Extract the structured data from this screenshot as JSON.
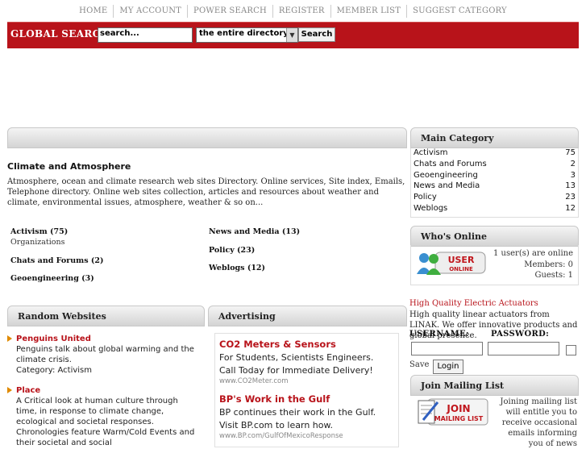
{
  "nav": [
    "HOME",
    "MY ACCOUNT",
    "POWER SEARCH",
    "REGISTER",
    "MEMBER LIST",
    "SUGGEST CATEGORY"
  ],
  "search": {
    "label": "GLOBAL SEARCH",
    "value": "search...",
    "scope": "the entire directory",
    "button": "Search"
  },
  "main": {
    "title": "Climate and Atmosphere",
    "description": "Atmosphere, ocean and climate research web sites Directory. Online services, Site index, Emails, Telephone directory. Online web sites collection, articles and resources about weather and climate, environmental issues, atmosphere, weather & so on...",
    "categories_left": [
      {
        "name": "Activism (75)",
        "sub": "Organizations"
      },
      {
        "name": "Chats and Forums (2)",
        "sub": ""
      },
      {
        "name": "Geoengineering (3)",
        "sub": ""
      }
    ],
    "categories_right": [
      {
        "name": "News and Media (13)"
      },
      {
        "name": "Policy (23)"
      },
      {
        "name": "Weblogs (12)"
      }
    ]
  },
  "main_category": {
    "title": "Main Category",
    "items": [
      {
        "label": "Activism",
        "count": "75"
      },
      {
        "label": "Chats and Forums",
        "count": "2"
      },
      {
        "label": "Geoengineering",
        "count": "3"
      },
      {
        "label": "News and Media",
        "count": "13"
      },
      {
        "label": "Policy",
        "count": "23"
      },
      {
        "label": "Weblogs",
        "count": "12"
      }
    ]
  },
  "whos_online": {
    "title": "Who's Online",
    "badge_line1": "USER",
    "badge_line2": "ONLINE",
    "lines": [
      "1 user(s) are online",
      "Members: 0",
      "Guests: 1"
    ]
  },
  "side_ad": {
    "title": "High Quality Electric Actuators",
    "text": "High quality linear actuators from LINAK. We offer innovative products and global presence."
  },
  "login": {
    "username_label": "USERNAME:",
    "password_label": "PASSWORD:",
    "save_label": "Save",
    "button": "Login"
  },
  "mailing": {
    "title": "Join Mailing List",
    "badge_line1": "JOIN",
    "badge_line2": "MAILING LIST",
    "text": "Joining mailing list will entitle you to receive occasional emails informing you of news"
  },
  "random": {
    "title": "Random Websites",
    "items": [
      {
        "title": "Penguins United",
        "desc": "Penguins talk about global warming and the climate crisis.",
        "category": "Category:    Activism"
      },
      {
        "title": "Place",
        "desc": "A Critical look at human culture through time, in response to climate change, ecological and societal responses. Chronologies feature Warm/Cold Events and their societal and social",
        "category": ""
      }
    ]
  },
  "advertising": {
    "title": "Advertising",
    "ads": [
      {
        "headline": "CO2 Meters & Sensors",
        "body": "For Students, Scientists Engineers. Call Today for Immediate Delivery!",
        "url": "www.CO2Meter.com"
      },
      {
        "headline": "BP's Work in the Gulf",
        "body": "BP continues their work in the Gulf. Visit BP.com to learn how.",
        "url": "www.BP.com/GulfOfMexicoResponse"
      }
    ]
  },
  "colors": {
    "brand_red": "#b8131a",
    "accent_orange": "#e08a00"
  }
}
